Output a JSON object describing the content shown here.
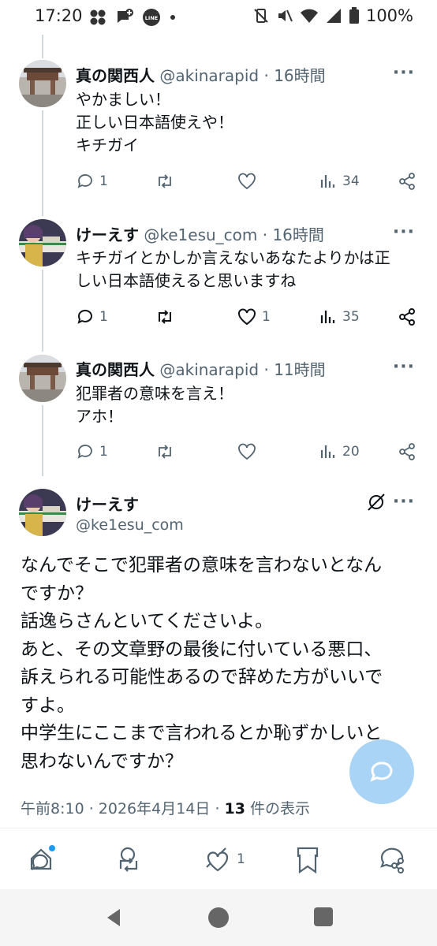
{
  "status_bar": {
    "time": "17:20",
    "battery": "100%"
  },
  "tweets": [
    {
      "name": "真の関西人",
      "handle": "@akinarapid",
      "time": "· 16時間",
      "lines": [
        "やかましい！",
        "正しい日本語使えや！",
        "キチガイ"
      ],
      "replies": "1",
      "retweets": "",
      "likes": "",
      "views": "34"
    },
    {
      "name": "けーえす",
      "handle": "@ke1esu_com",
      "time": "· 16時間",
      "lines": [
        "キチガイとかしか言えないあなたよりかは正",
        "しい日本語使えると思いますね"
      ],
      "replies": "1",
      "retweets": "",
      "likes": "1",
      "views": "35"
    },
    {
      "name": "真の関西人",
      "handle": "@akinarapid",
      "time": "· 11時間",
      "lines": [
        "犯罪者の意味を言え！",
        "アホ！"
      ],
      "replies": "1",
      "retweets": "",
      "likes": "",
      "views": "20"
    }
  ],
  "main_tweet": {
    "name": "けーえす",
    "handle": "@ke1esu_com",
    "lines": [
      "なんでそこで犯罪者の意味を言わないとなん",
      "ですか？",
      "話逸らさんといてくださいよ。",
      "あと、その文章野の最後に付いている悪口、",
      "訴えられる可能性あるので辞めた方がいいで",
      "すよ。",
      "中学生にここまで言われるとか恥ずかしいと",
      "思わないんですか？"
    ],
    "timestamp": "午前8:10 · 2026年4月14日 · ",
    "view_count": "13",
    "view_label": " 件の表示",
    "like_count": "1"
  },
  "more_label": "···",
  "colors": {
    "accent": "#1d9bf0",
    "fab": "#a9d4f5",
    "muted": "#536471",
    "thread_line": "#cfd9de"
  },
  "icons": [
    "reply-icon",
    "retweet-icon",
    "like-icon",
    "views-icon",
    "share-icon",
    "grok-icon",
    "compose-icon",
    "bookmark-icon"
  ]
}
